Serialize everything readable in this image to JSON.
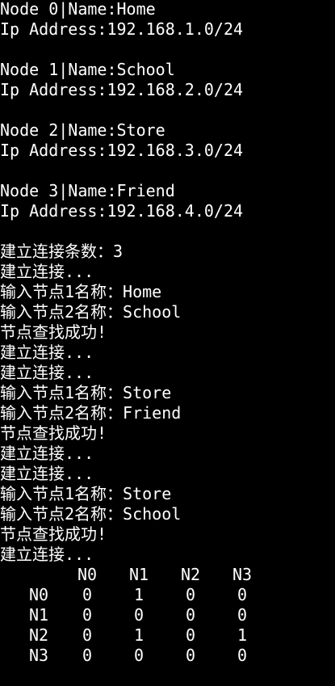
{
  "console": {
    "foreground": "#ffffff",
    "background": "#000000",
    "lines": [
      "Node 0|Name:Home",
      "Ip Address:192.168.1.0/24",
      "",
      "Node 1|Name:School",
      "Ip Address:192.168.2.0/24",
      "",
      "Node 2|Name:Store",
      "Ip Address:192.168.3.0/24",
      "",
      "Node 3|Name:Friend",
      "Ip Address:192.168.4.0/24",
      "",
      "建立连接条数：3",
      "建立连接...",
      "输入节点1名称：Home",
      "输入节点2名称：School",
      "节点查找成功!",
      "建立连接...",
      "建立连接...",
      "输入节点1名称：Store",
      "输入节点2名称：Friend",
      "节点查找成功!",
      "建立连接...",
      "建立连接...",
      "输入节点1名称：Store",
      "输入节点2名称：School",
      "节点查找成功!",
      "建立连接..."
    ]
  },
  "matrix": {
    "col_headers": [
      "N0",
      "N1",
      "N2",
      "N3"
    ],
    "rows": [
      {
        "label": "N0",
        "values": [
          "0",
          "1",
          "0",
          "0"
        ]
      },
      {
        "label": "N1",
        "values": [
          "0",
          "0",
          "0",
          "0"
        ]
      },
      {
        "label": "N2",
        "values": [
          "0",
          "1",
          "0",
          "1"
        ]
      },
      {
        "label": "N3",
        "values": [
          "0",
          "0",
          "0",
          "0"
        ]
      }
    ]
  }
}
